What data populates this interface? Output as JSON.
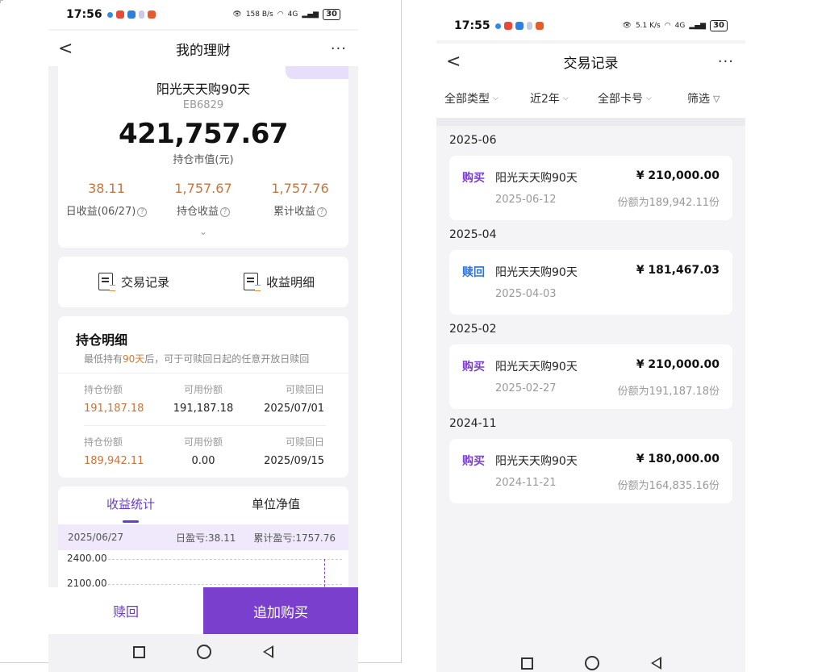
{
  "left": {
    "status": {
      "time": "17:56",
      "speed": "158 B/s",
      "signal": "4G",
      "battery": "30"
    },
    "nav": {
      "back": "<",
      "title": "我的理财",
      "more": "···"
    },
    "summary": {
      "product_name": "阳光天天购90天",
      "product_code": "EB6829",
      "market_value": "421,757.67",
      "market_value_label": "持仓市值(元)",
      "stats": [
        {
          "value": "38.11",
          "label": "日收益(06/27)"
        },
        {
          "value": "1,757.67",
          "label": "持仓收益"
        },
        {
          "value": "1,757.76",
          "label": "累计收益"
        }
      ],
      "help": "?",
      "expand": "⌄"
    },
    "quick_links": {
      "records": "交易记录",
      "income_detail": "收益明细"
    },
    "holdings": {
      "title": "持仓明细",
      "note_prefix": "最低持有",
      "note_highlight": "90天",
      "note_suffix": "后，可于可赎回日起的任意开放日赎回",
      "rows": [
        {
          "held_label": "持仓份额",
          "held": "191,187.18",
          "avail_label": "可用份额",
          "avail": "191,187.18",
          "date_label": "可赎回日",
          "date": "2025/07/01"
        },
        {
          "held_label": "持仓份额",
          "held": "189,942.11",
          "avail_label": "可用份额",
          "avail": "0.00",
          "date_label": "可赎回日",
          "date": "2025/09/15"
        }
      ]
    },
    "tabs": {
      "income_stats": "收益统计",
      "unit_nav": "单位净值"
    },
    "chart": {
      "date": "2025/06/27",
      "daily": "日盈亏:38.11",
      "cumulative": "累计盈亏:1757.76",
      "y_labels": [
        "2400.00",
        "2100.00"
      ]
    },
    "bottom": {
      "redeem": "赎回",
      "buy_more": "追加购买"
    }
  },
  "right": {
    "status": {
      "time": "17:55",
      "speed": "5.1 K/s",
      "signal": "4G",
      "battery": "30"
    },
    "nav": {
      "back": "<",
      "title": "交易记录",
      "more": "···"
    },
    "filters": {
      "type": "全部类型",
      "period": "近2年",
      "card": "全部卡号",
      "screen": "筛选"
    },
    "groups": [
      {
        "month": "2025-06",
        "tx": {
          "type": "购买",
          "kind": "buy",
          "name": "阳光天天购90天",
          "amount": "¥ 210,000.00",
          "date": "2025-06-12",
          "shares": "份额为189,942.11份"
        }
      },
      {
        "month": "2025-04",
        "tx": {
          "type": "赎回",
          "kind": "redeem",
          "name": "阳光天天购90天",
          "amount": "¥ 181,467.03",
          "date": "2025-04-03",
          "shares": ""
        }
      },
      {
        "month": "2025-02",
        "tx": {
          "type": "购买",
          "kind": "buy",
          "name": "阳光天天购90天",
          "amount": "¥ 210,000.00",
          "date": "2025-02-27",
          "shares": "份额为191,187.18份"
        }
      },
      {
        "month": "2024-11",
        "tx": {
          "type": "购买",
          "kind": "buy",
          "name": "阳光天天购90天",
          "amount": "¥ 180,000.00",
          "date": "2024-11-21",
          "shares": "份额为164,835.16份"
        }
      }
    ]
  },
  "colors": {
    "accent": "#7a3fcc",
    "gain": "#c8743c",
    "redeem": "#2f74d0"
  }
}
